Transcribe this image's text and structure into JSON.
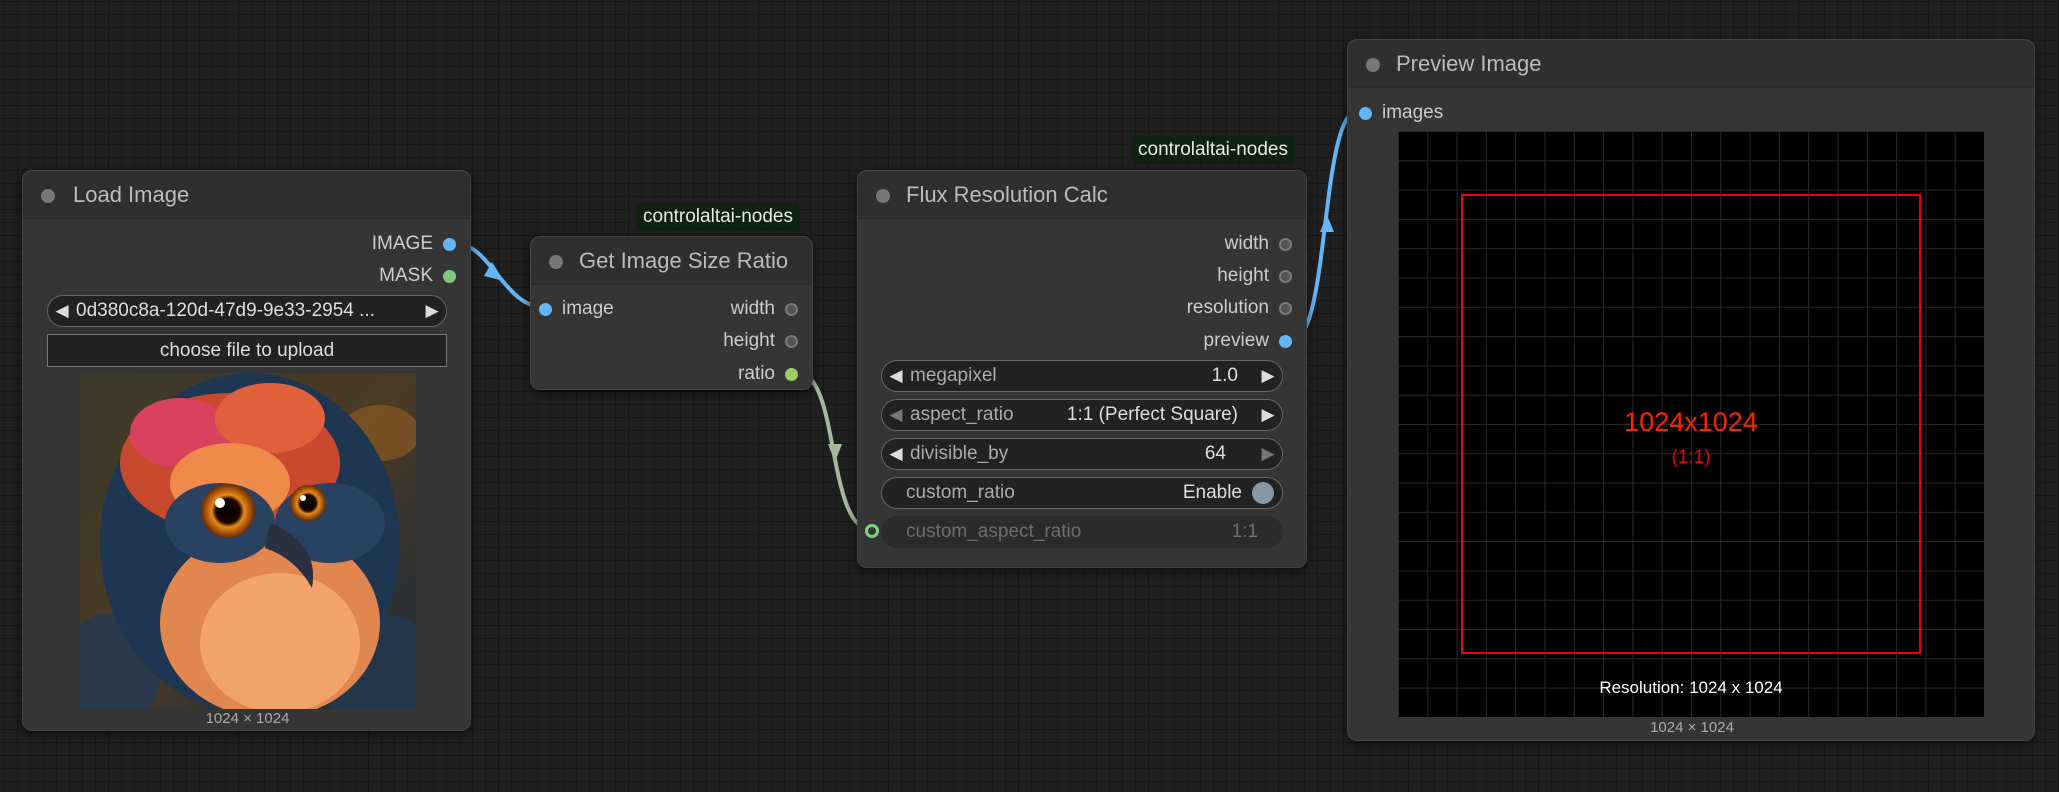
{
  "nodes": {
    "load_image": {
      "title": "Load Image",
      "outputs": {
        "image": "IMAGE",
        "mask": "MASK"
      },
      "image_selector": {
        "value": "0d380c8a-120d-47d9-9e33-2954 ...",
        "arrow_left": "◀",
        "arrow_right": "▶"
      },
      "upload_label": "choose file to upload",
      "image_description": "owl",
      "dims": "1024 × 1024"
    },
    "get_image_size_ratio": {
      "title": "Get Image Size Ratio",
      "badge": "controlaltai-nodes",
      "input": "image",
      "outputs": {
        "width": "width",
        "height": "height",
        "ratio": "ratio"
      }
    },
    "flux_resolution_calc": {
      "title": "Flux Resolution Calc",
      "badge": "controlaltai-nodes",
      "outputs": {
        "width": "width",
        "height": "height",
        "resolution": "resolution",
        "preview": "preview"
      },
      "widgets": {
        "megapixel": {
          "name": "megapixel",
          "value": "1.0"
        },
        "aspect_ratio": {
          "name": "aspect_ratio",
          "value": "1:1 (Perfect Square)"
        },
        "divisible_by": {
          "name": "divisible_by",
          "value": "64"
        },
        "custom_ratio": {
          "name": "custom_ratio",
          "value": "Enable"
        },
        "custom_aspect_ratio": {
          "name": "custom_aspect_ratio",
          "value": "1:1"
        }
      }
    },
    "preview_image": {
      "title": "Preview Image",
      "input": "images",
      "preview": {
        "resolution_text": "1024x1024",
        "ratio_text": "(1:1)",
        "footer_text": "Resolution: 1024 x 1024"
      },
      "dims": "1024 × 1024"
    }
  },
  "colors": {
    "image_link": "#64b5f6",
    "ratio_link": "#a8b8a0",
    "preview_accent": "#ee0000"
  }
}
